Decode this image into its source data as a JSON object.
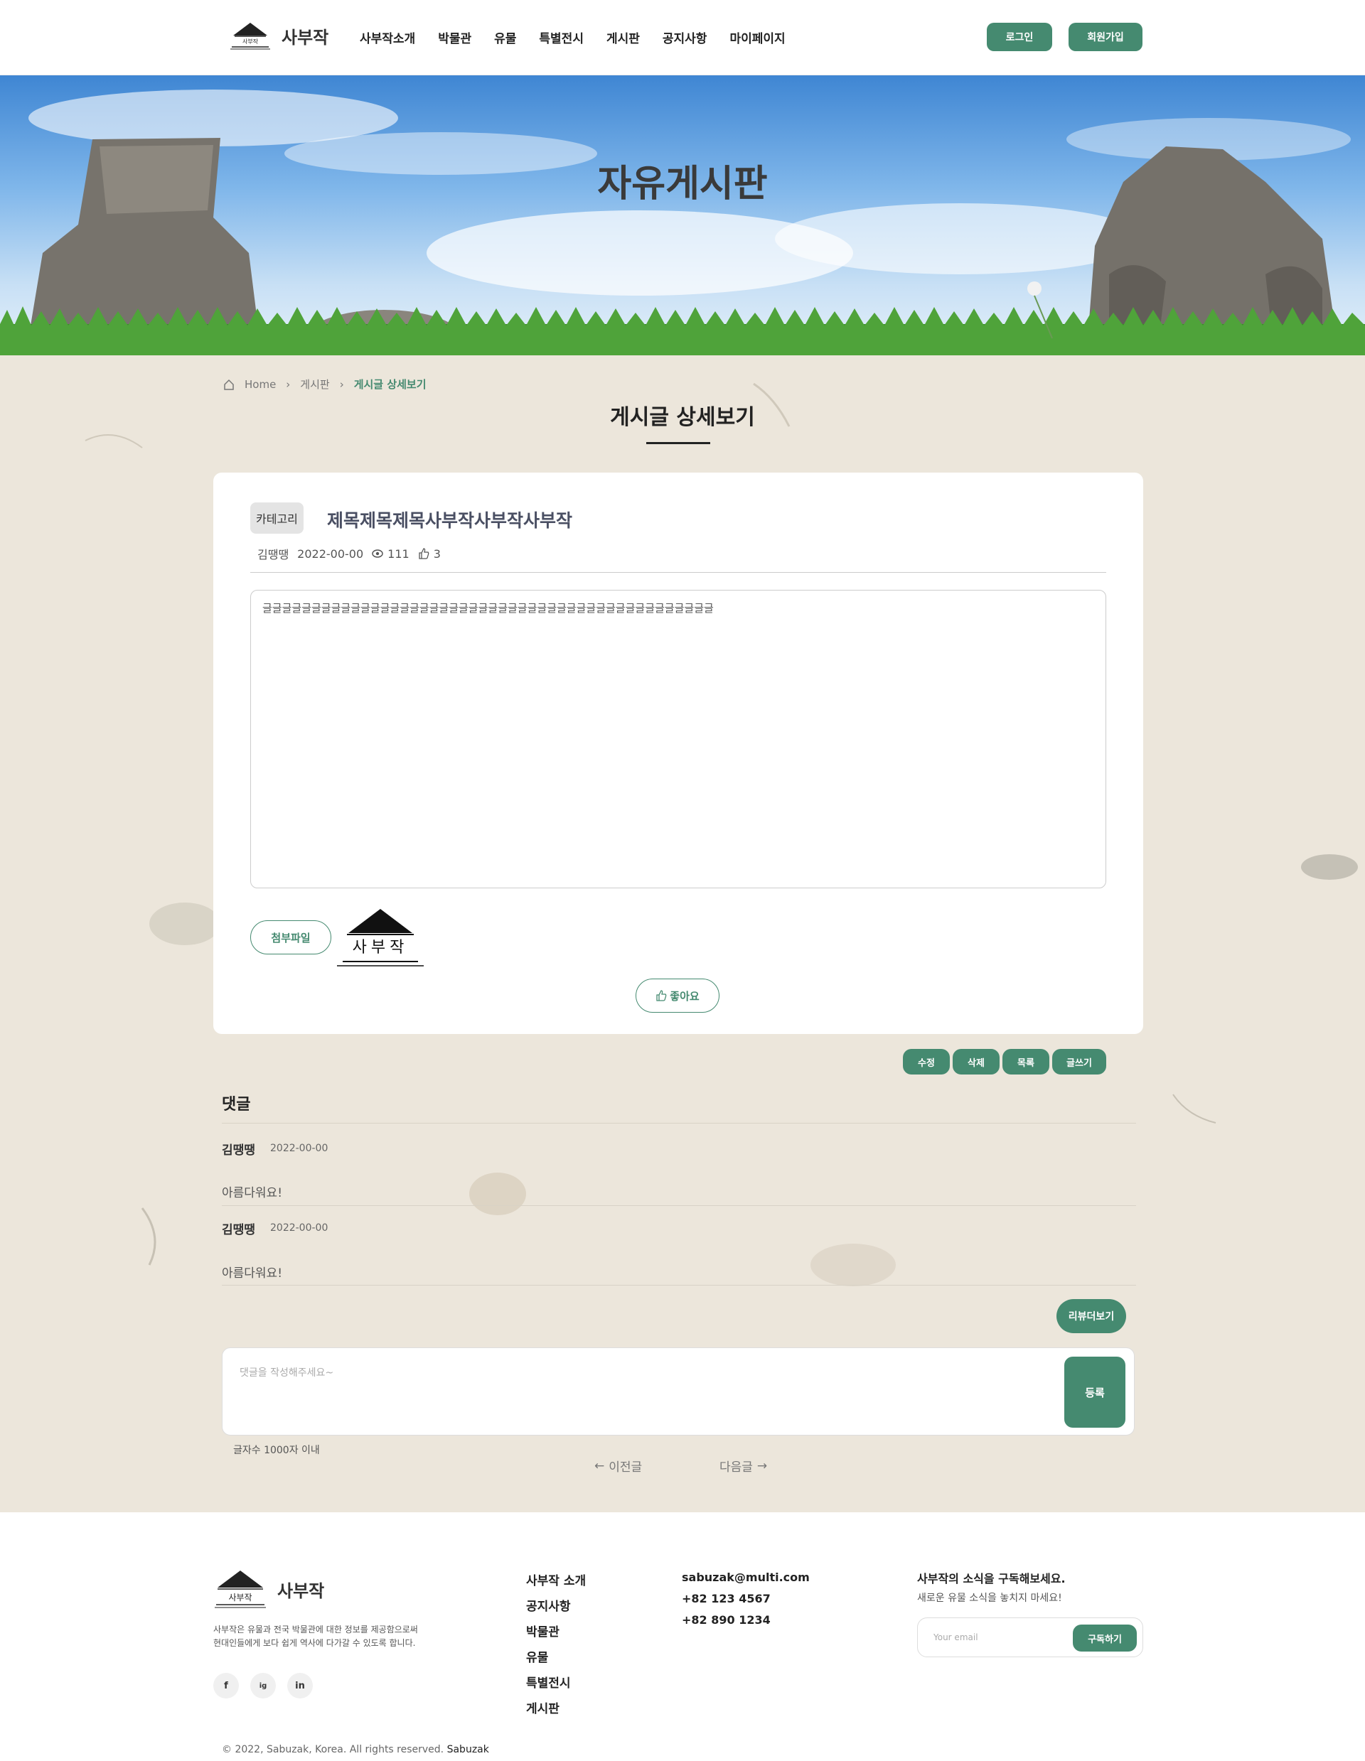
{
  "header": {
    "logo_glyph": "사부작",
    "logo_text": "사부작",
    "nav": [
      "사부작소개",
      "박물관",
      "유물",
      "특별전시",
      "게시판",
      "공지사항",
      "마이페이지"
    ],
    "login": "로그인",
    "signup": "회원가입"
  },
  "banner": {
    "title": "자유게시판"
  },
  "breadcrumb": {
    "home": "Home",
    "board": "게시판",
    "current": "게시글 상세보기"
  },
  "page_title": "게시글 상세보기",
  "post": {
    "category": "카테고리",
    "title": "제목제목제목사부작사부작사부작",
    "author": "김땡땡",
    "date": "2022-00-00",
    "views": "111",
    "likes": "3",
    "body": "글글글글글글글글글글글글글글글글글글글글글글글글글글글글글글글글글글글글글글글글글글글글글글",
    "attach_label": "첨부파일",
    "attach_image_text": "사부작",
    "like_label": "좋아요"
  },
  "actions": {
    "edit": "수정",
    "delete": "삭제",
    "list": "목록",
    "write": "글쓰기"
  },
  "comments": {
    "heading": "댓글",
    "items": [
      {
        "name": "김땡땡",
        "date": "2022-00-00",
        "text": "아름다워요!"
      },
      {
        "name": "김땡땡",
        "date": "2022-00-00",
        "text": "아름다워요!"
      }
    ],
    "reader_button": "리뷰더보기",
    "placeholder": "댓글을 작성해주세요~",
    "submit": "등록",
    "limit": "글자수 1000자 이내"
  },
  "pager": {
    "prev": "이전글",
    "next": "다음글"
  },
  "footer": {
    "logo_glyph": "사부작",
    "logo_text": "사부작",
    "desc_line1": "사부작은 유물과 전국 박물관에 대한 정보를 제공함으로써",
    "desc_line2": "현대인들에게 보다 쉽게 역사에 다가갈 수 있도록 합니다.",
    "social": [
      "f",
      "ig",
      "in"
    ],
    "links": [
      "사부작 소개",
      "공지사항",
      "박물관",
      "유물",
      "특별전시",
      "게시판"
    ],
    "contact": [
      "sabuzak@multi.com",
      "+82 123 4567",
      "+82 890 1234"
    ],
    "subscribe_title": "사부작의 소식을 구독해보세요.",
    "subscribe_desc": "새로운 유물 소식을 놓치지 마세요!",
    "email_placeholder": "Your email",
    "subscribe_button": "구독하기",
    "copyright": "© 2022, Sabuzak, Korea. All rights reserved.",
    "copyright_brand": "Sabuzak"
  },
  "colors": {
    "accent": "#458a70",
    "background": "#ece6db"
  }
}
